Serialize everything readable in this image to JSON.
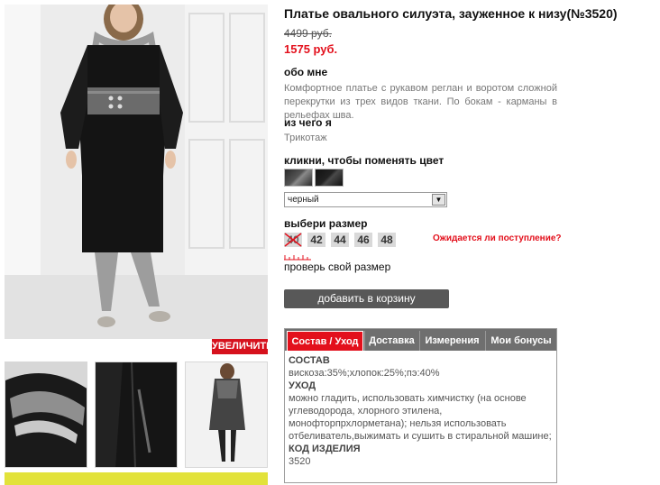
{
  "product": {
    "title": "Платье овального силуэта, зауженное к низу(№3520)",
    "old_price": "4499 руб.",
    "new_price": "1575 руб."
  },
  "about": {
    "heading": "обо мне",
    "text": "Комфортное платье с рукавом реглан и воротом сложной перекрутки из трех видов ткани. По бокам - карманы в рельефах шва."
  },
  "material": {
    "heading": "из чего я",
    "text": "Трикотаж"
  },
  "color": {
    "heading": "кликни, чтобы поменять цвет",
    "selected": "черный",
    "swatches": [
      "grey-black",
      "black"
    ]
  },
  "size": {
    "heading": "выбери размер",
    "options": [
      "40",
      "42",
      "44",
      "46",
      "48"
    ],
    "unavailable": [
      "40"
    ],
    "waiting_link": "Ожидается ли поступление?",
    "check_size_link": "проверь свой размер"
  },
  "cart": {
    "button_label": "добавить в корзину"
  },
  "gallery": {
    "zoom_label": "УВЕЛИЧИТЬ"
  },
  "tabs": {
    "items": [
      "Состав / Уход",
      "Доставка",
      "Измерения",
      "Мои бонусы"
    ],
    "active": "Состав / Уход",
    "content": {
      "composition_heading": "СОСТАВ",
      "composition_text": "вискоза:35%;хлопок:25%;пэ:40%",
      "care_heading": "УХОД",
      "care_text": "можно гладить, использовать химчистку (на основе углеводорода, хлорного этилена, монофторпрхлорметана); нельзя использовать отбеливатель,выжимать и сушить в стиральной машине;",
      "code_heading": "КОД ИЗДЕЛИЯ",
      "code_text": "3520"
    }
  },
  "colors": {
    "accent": "#e3101c",
    "tab_bar": "#6f6f6f",
    "button": "#585858"
  }
}
